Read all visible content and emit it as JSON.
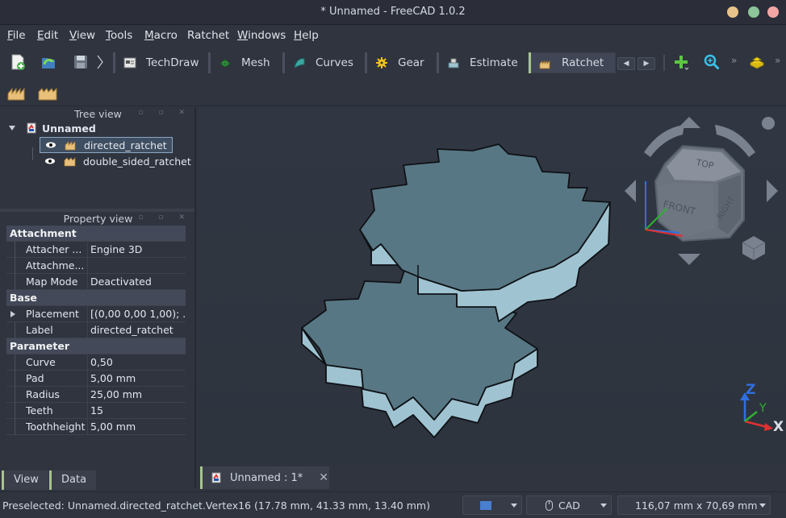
{
  "window": {
    "title": "* Unnamed - FreeCAD 1.0.2"
  },
  "menu": [
    {
      "u": "F",
      "rest": "ile"
    },
    {
      "u": "E",
      "rest": "dit"
    },
    {
      "u": "V",
      "rest": "iew"
    },
    {
      "u": "T",
      "rest": "ools"
    },
    {
      "u": "M",
      "rest": "acro"
    },
    {
      "u": "",
      "rest": "Ratchet"
    },
    {
      "u": "W",
      "rest": "indows"
    },
    {
      "u": "H",
      "rest": "elp"
    }
  ],
  "workbenches": {
    "techdraw": "TechDraw",
    "mesh": "Mesh",
    "curves": "Curves",
    "gear": "Gear",
    "estimate": "Estimate",
    "ratchet": "Ratchet"
  },
  "tree_view": {
    "title": "Tree view",
    "document": "Unnamed",
    "items": [
      "directed_ratchet",
      "double_sided_ratchet"
    ]
  },
  "property_view": {
    "title": "Property view",
    "groups": {
      "attachment": "Attachment",
      "base": "Base",
      "parameter": "Parameter"
    },
    "rows": {
      "attacher_key": "Attacher ...",
      "attacher_val": "Engine 3D",
      "attachment_key": "Attachme...",
      "attachment_val": "",
      "mapmode_key": "Map Mode",
      "mapmode_val": "Deactivated",
      "placement_key": "Placement",
      "placement_val": "[(0,00 0,00 1,00); ...",
      "label_key": "Label",
      "label_val": "directed_ratchet",
      "curve_key": "Curve",
      "curve_val": "0,50",
      "pad_key": "Pad",
      "pad_val": "5,00 mm",
      "radius_key": "Radius",
      "radius_val": "25,00 mm",
      "teeth_key": "Teeth",
      "teeth_val": "15",
      "toothheight_key": "Toothheight",
      "toothheight_val": "5,00 mm"
    },
    "tabs": {
      "view": "View",
      "data": "Data"
    }
  },
  "navcube": {
    "top": "TOP",
    "front": "FRONT",
    "right": "RIGHT"
  },
  "axes": {
    "z": "Z",
    "y": "Y",
    "x": "X"
  },
  "doc_tab": {
    "label": "Unnamed : 1*"
  },
  "status": {
    "message": "Preselected: Unnamed.directed_ratchet.Vertex16 (17.78 mm, 41.33 mm, 13.40 mm)",
    "nav_style": "CAD",
    "dimensions": "116,07 mm x 70,69 mm"
  },
  "colors": {
    "gear_face": "#587784",
    "gear_side": "#9fc3d1",
    "accent": "#a8c48e",
    "background": "#2f343f"
  }
}
